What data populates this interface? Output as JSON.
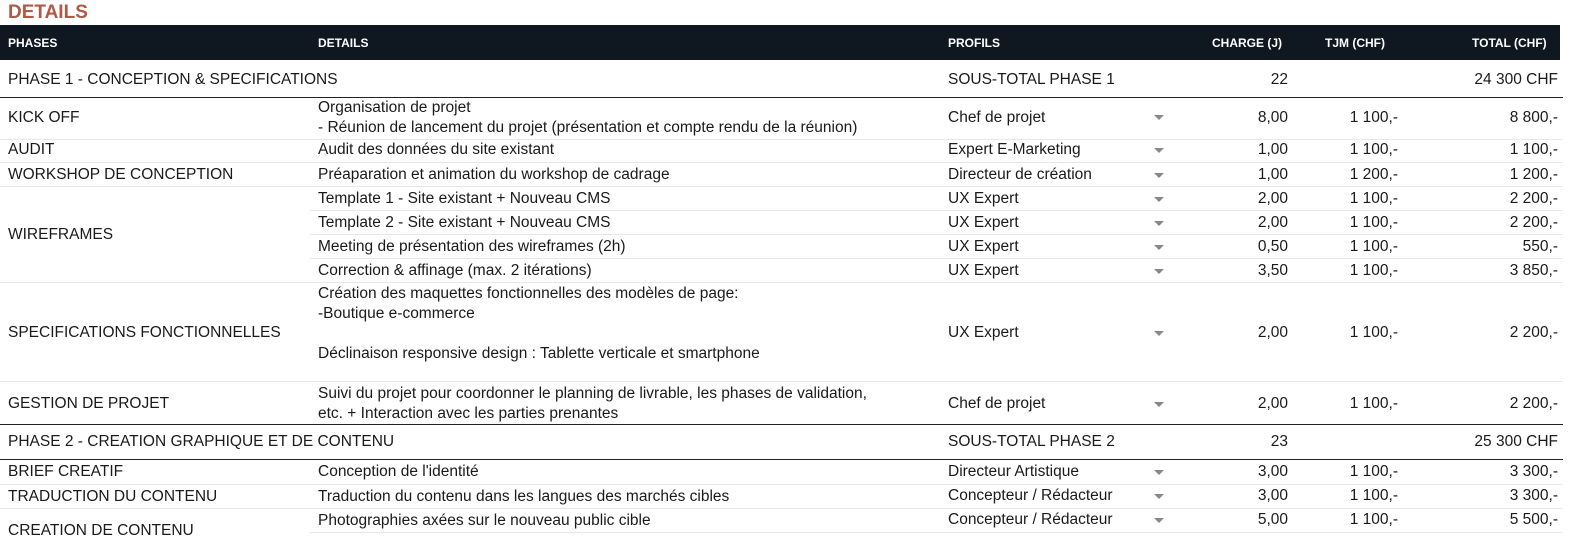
{
  "title": "DETAILS",
  "headers": {
    "phases": "PHASES",
    "details": "DETAILS",
    "profils": "PROFILS",
    "charge": "CHARGE (J)",
    "tjm": "TJM (CHF)",
    "total": "TOTAL (CHF)"
  },
  "phase1": {
    "name": "PHASE 1 - CONCEPTION & SPECIFICATIONS",
    "subtotal_label": "SOUS-TOTAL PHASE 1",
    "charge": "22",
    "total": "24 300 CHF"
  },
  "phase2": {
    "name": "PHASE 2 - CREATION GRAPHIQUE ET DE CONTENU",
    "subtotal_label": "SOUS-TOTAL PHASE 2",
    "charge": "23",
    "total": "25 300 CHF"
  },
  "rows": {
    "kickoff": {
      "phase": "KICK OFF",
      "detail1": "Organisation de projet",
      "detail2": "- Réunion de lancement du projet (présentation et compte rendu de la réunion)",
      "profil": "Chef de projet",
      "charge": "8,00",
      "tjm": "1 100,-",
      "total": "8 800,-"
    },
    "audit": {
      "phase": "AUDIT",
      "detail": "Audit des données du site existant",
      "profil": "Expert E-Marketing",
      "charge": "1,00",
      "tjm": "1 100,-",
      "total": "1 100,-"
    },
    "workshop": {
      "phase": "WORKSHOP DE CONCEPTION",
      "detail": "Préaparation et animation du workshop de cadrage",
      "profil": "Directeur de création",
      "charge": "1,00",
      "tjm": "1 200,-",
      "total": "1 200,-"
    },
    "wireframes": {
      "phase": "WIREFRAMES",
      "items": [
        {
          "detail": "Template 1 - Site existant + Nouveau CMS",
          "profil": "UX Expert",
          "charge": "2,00",
          "tjm": "1 100,-",
          "total": "2 200,-"
        },
        {
          "detail": "Template 2 - Site existant + Nouveau CMS",
          "profil": "UX Expert",
          "charge": "2,00",
          "tjm": "1 100,-",
          "total": "2 200,-"
        },
        {
          "detail": "Meeting de présentation des wireframes (2h)",
          "profil": "UX Expert",
          "charge": "0,50",
          "tjm": "1 100,-",
          "total": "550,-"
        },
        {
          "detail": "Correction & affinage (max. 2 itérations)",
          "profil": "UX Expert",
          "charge": "3,50",
          "tjm": "1 100,-",
          "total": "3 850,-"
        }
      ]
    },
    "specs": {
      "phase": "SPECIFICATIONS FONCTIONNELLES",
      "detail1": "Création des maquettes fonctionnelles des modèles de page:",
      "detail2": "-Boutique e-commerce",
      "detail3": "Déclinaison responsive design : Tablette verticale et smartphone",
      "profil": "UX Expert",
      "charge": "2,00",
      "tjm": "1 100,-",
      "total": "2 200,-"
    },
    "gestion": {
      "phase": "GESTION DE PROJET",
      "detail1": "Suivi du projet pour coordonner le planning de livrable, les phases de validation,",
      "detail2": "etc. + Interaction avec les parties prenantes",
      "profil": "Chef de projet",
      "charge": "2,00",
      "tjm": "1 100,-",
      "total": "2 200,-"
    },
    "brief": {
      "phase": "BRIEF CREATIF",
      "detail": "Conception de l'identité",
      "profil": "Directeur Artistique",
      "charge": "3,00",
      "tjm": "1 100,-",
      "total": "3 300,-"
    },
    "traduction": {
      "phase": "TRADUCTION DU CONTENU",
      "detail": "Traduction du contenu dans les langues des marchés cibles",
      "profil": "Concepteur / Rédacteur",
      "charge": "3,00",
      "tjm": "1 100,-",
      "total": "3 300,-"
    },
    "creation": {
      "phase": "CREATION DE CONTENU",
      "detail": "Photographies axées sur le nouveau public cible",
      "profil": "Concepteur / Rédacteur",
      "charge": "5,00",
      "tjm": "1 100,-",
      "total": "5 500,-"
    }
  },
  "icons": {
    "dropdown": "caret-down-icon"
  },
  "colors": {
    "title": "#b05a45",
    "header_bg": "#0f1820"
  }
}
